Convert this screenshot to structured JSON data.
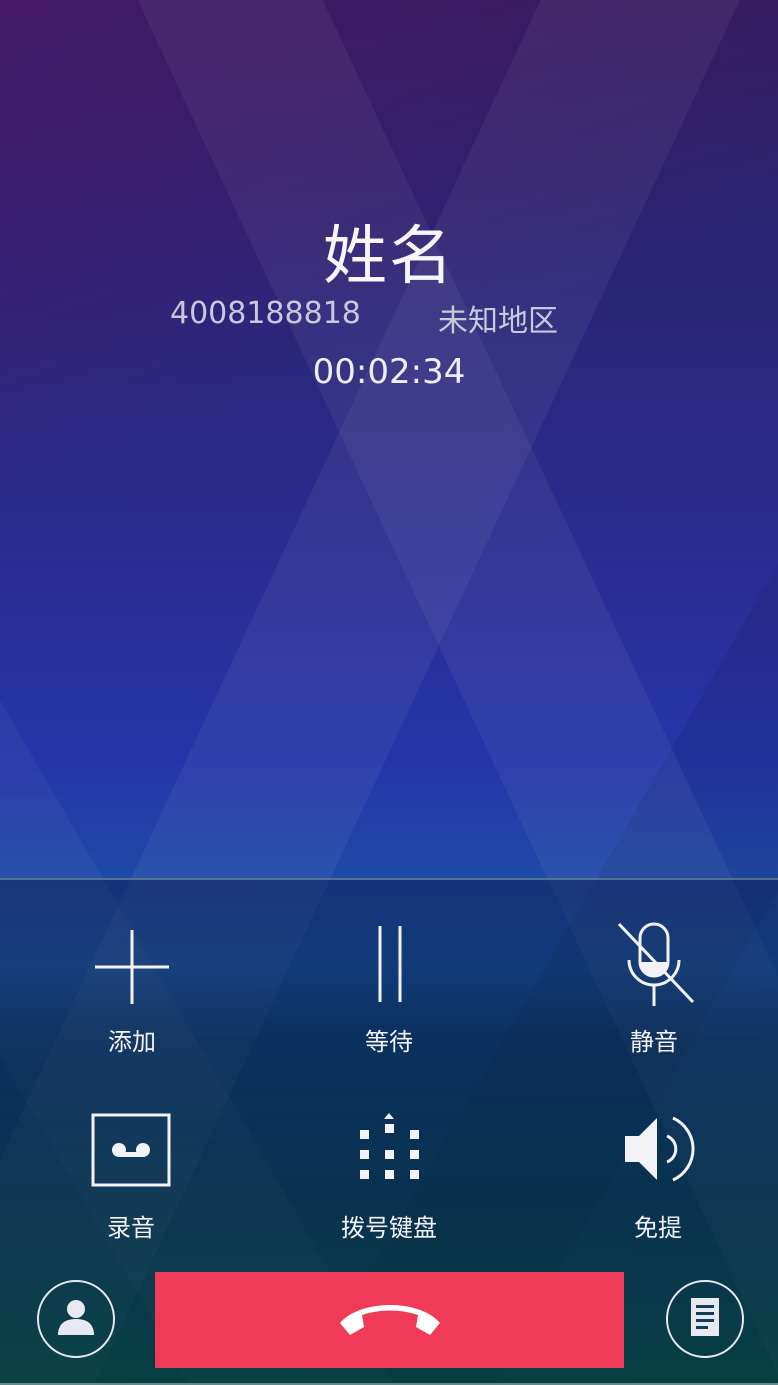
{
  "caller": {
    "name": "姓名",
    "number": "4008188818",
    "region": "未知地区",
    "duration": "00:02:34"
  },
  "controls": [
    {
      "id": "add",
      "label": "添加",
      "icon": "plus-icon"
    },
    {
      "id": "hold",
      "label": "等待",
      "icon": "pause-icon"
    },
    {
      "id": "mute",
      "label": "静音",
      "icon": "mic-off-icon"
    },
    {
      "id": "record",
      "label": "录音",
      "icon": "voicemail-icon"
    },
    {
      "id": "keypad",
      "label": "拨号键盘",
      "icon": "dialpad-icon"
    },
    {
      "id": "speaker",
      "label": "免提",
      "icon": "speaker-icon"
    }
  ],
  "bottom_bar": {
    "contact_icon": "person-icon",
    "end_call_icon": "hangup-phone-icon",
    "notes_icon": "note-icon"
  },
  "colors": {
    "end_call": "#ef3b57",
    "text": "#f2f2f7"
  }
}
